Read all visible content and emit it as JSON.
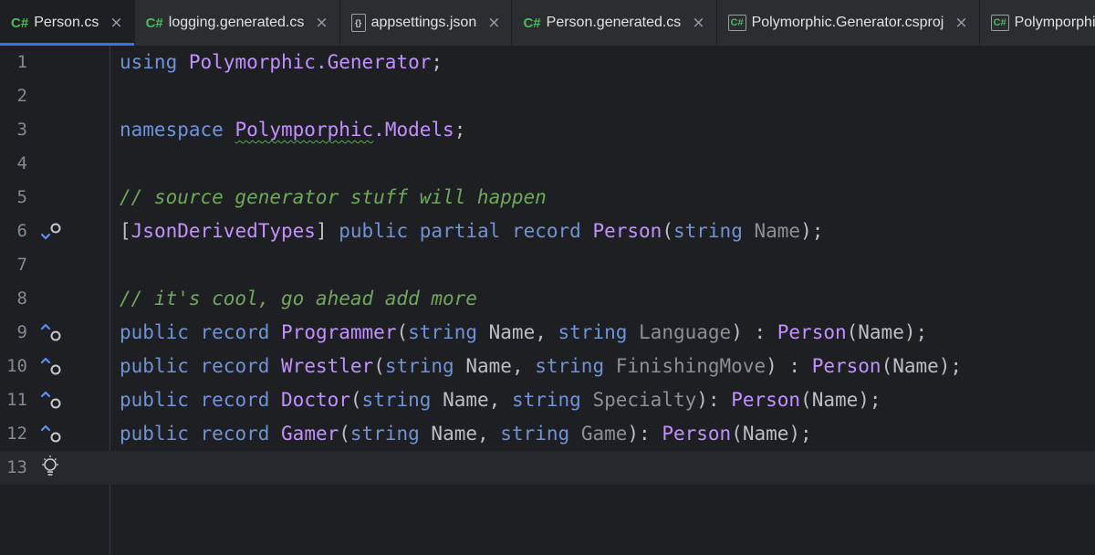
{
  "tabs": [
    {
      "icon": "C#",
      "label": "Person.cs",
      "close": "×",
      "active": true
    },
    {
      "icon": "C#",
      "label": "logging.generated.cs",
      "close": "×",
      "active": false
    },
    {
      "icon": "{}",
      "label": "appsettings.json",
      "close": "×",
      "active": false
    },
    {
      "icon": "C#",
      "label": "Person.generated.cs",
      "close": "×",
      "active": false
    },
    {
      "icon": "C#",
      "label": "Polymorphic.Generator.csproj",
      "close": "×",
      "active": false
    },
    {
      "icon": "C#",
      "label": "Polymporphic.cs",
      "close": "",
      "active": false
    }
  ],
  "editor": {
    "line_numbers": [
      "1",
      "2",
      "3",
      "4",
      "5",
      "6",
      "7",
      "8",
      "9",
      "10",
      "11",
      "12",
      "13"
    ],
    "lines": [
      {
        "using_kw": "using",
        "ns": "Polymorphic.Generator",
        "semi": ";"
      },
      {},
      {
        "ns_kw": "namespace",
        "ns_squiggle": "Polymporphic",
        "ns_rest": ".Models",
        "semi": ";"
      },
      {},
      {
        "comment": "// source generator stuff will happen"
      },
      {
        "lbr": "[",
        "attr": "JsonDerivedTypes",
        "rbr": "]",
        "kw1": "public",
        "kw2": "partial",
        "kw3": "record",
        "type": "Person",
        "open": "(",
        "kw4": "string",
        "param": "Name",
        "close": ");"
      },
      {},
      {
        "comment": "// it's cool, go ahead add more"
      },
      {
        "kw1": "public",
        "kw2": "record",
        "type": "Programmer",
        "open": "(",
        "kw3": "string",
        "p1": "Name",
        "comma": ", ",
        "kw4": "string",
        "p2": "Language",
        "sep": ") : ",
        "base": "Person",
        "args": "(Name);"
      },
      {
        "kw1": "public",
        "kw2": "record",
        "type": "Wrestler",
        "open": "(",
        "kw3": "string",
        "p1": "Name",
        "comma": ", ",
        "kw4": "string",
        "p2": "FinishingMove",
        "sep": ") : ",
        "base": "Person",
        "args": "(Name);"
      },
      {
        "kw1": "public",
        "kw2": "record",
        "type": "Doctor",
        "open": "(",
        "kw3": "string",
        "p1": "Name",
        "comma": ", ",
        "kw4": "string",
        "p2": "Specialty",
        "sep": "): ",
        "base": "Person",
        "args": "(Name);"
      },
      {
        "kw1": "public",
        "kw2": "record",
        "type": "Gamer",
        "open": "(",
        "kw3": "string",
        "p1": "Name",
        "comma": ", ",
        "kw4": "string",
        "p2": "Game",
        "sep": "): ",
        "base": "Person",
        "args": "(Name);"
      },
      {}
    ]
  },
  "colors": {
    "background": "#1e1f22",
    "keyword": "#6f93d6",
    "type": "#c191ff",
    "comment": "#6fa85b",
    "plain": "#bcbec4",
    "parameter_unused": "#8c8f96",
    "tab_accent": "#3574f0"
  },
  "icons": {
    "gutter_line6": "implemented-down-icon",
    "gutter_line9_12": "implements-up-icon",
    "gutter_line13": "lightbulb-icon"
  }
}
